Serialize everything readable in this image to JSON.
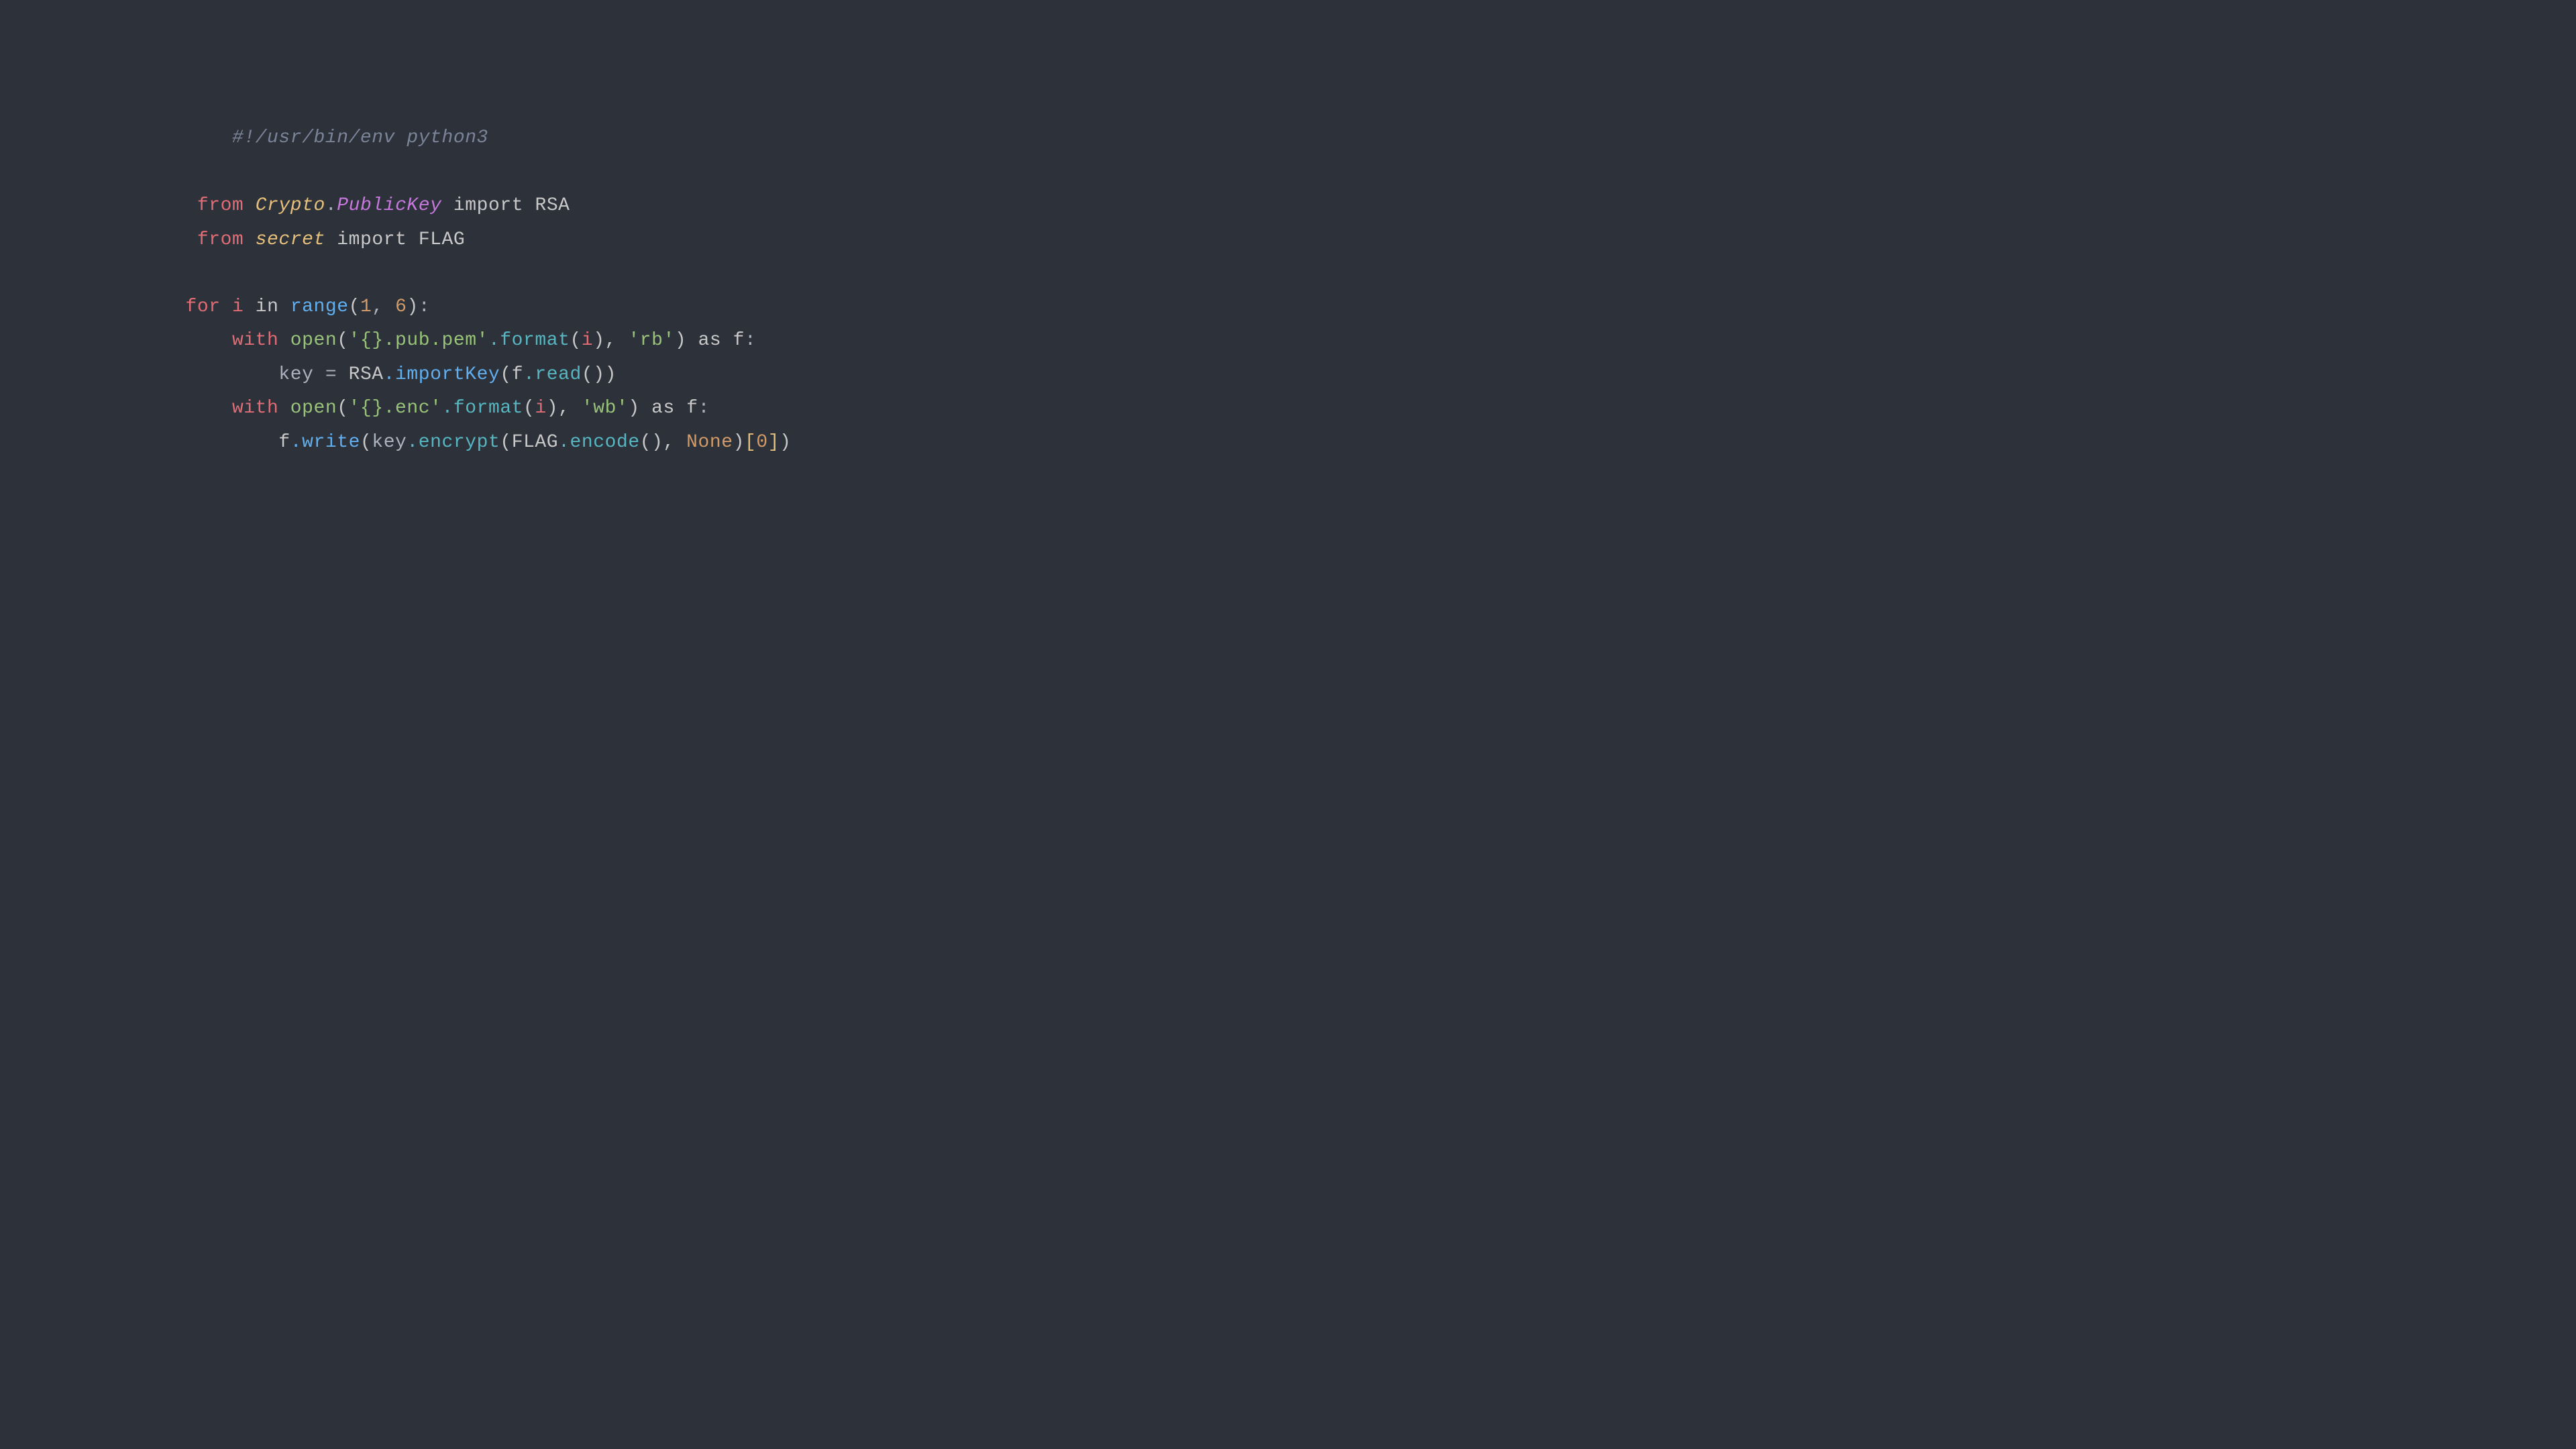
{
  "background": "#2d3139",
  "code": {
    "line1": "#!/usr/bin/env python3",
    "line2_from": "from",
    "line2_module": "Crypto.PublicKey",
    "line2_import": "import",
    "line2_name": "RSA",
    "line3_from": "from",
    "line3_module": "secret",
    "line3_import": "import",
    "line3_name": "FLAG",
    "line4_for": "for",
    "line4_i": "i",
    "line4_in": "in",
    "line4_range": "range",
    "line4_args": "(1, 6):",
    "line5_with": "with",
    "line5_open": "open",
    "line5_str1": "'{}.pub.pem'",
    "line5_format": ".format",
    "line5_args1": "(i),",
    "line5_str2": "'rb'",
    "line5_as": "as",
    "line5_f": "f:",
    "line6_key": "key",
    "line6_eq": "=",
    "line6_rsa": "RSA",
    "line6_importkey": ".importKey",
    "line6_fread": "(f.read())",
    "line7_with": "with",
    "line7_open": "open",
    "line7_str1": "'{}.enc'",
    "line7_format": ".format",
    "line7_args1": "(i),",
    "line7_str2": "'wb'",
    "line7_as": "as",
    "line7_f": "f:",
    "line8_f": "f",
    "line8_write": ".write",
    "line8_key": "(key",
    "line8_encrypt": ".encrypt",
    "line8_flag": "(FLAG",
    "line8_encode": ".encode",
    "line8_none": "(), None)",
    "line8_index": "[0])"
  }
}
